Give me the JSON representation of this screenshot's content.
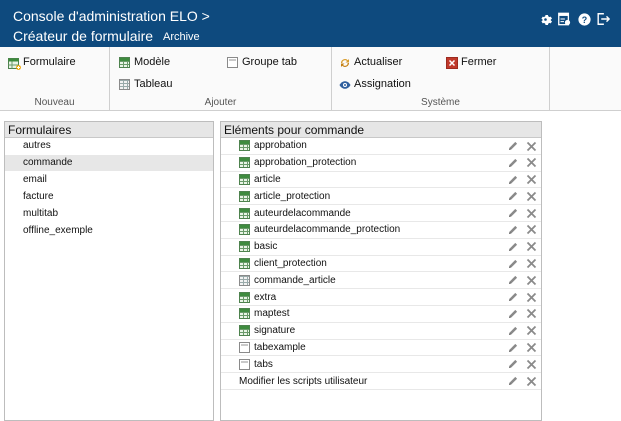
{
  "header": {
    "title_line1": "Console d'administration ELO >",
    "title_line2": "Créateur de formulaire",
    "breadcrumb": "Archive",
    "icons": [
      "gear-icon",
      "document-settings-icon",
      "help-icon",
      "logout-icon"
    ]
  },
  "ribbon": {
    "groups": {
      "nouveau": {
        "label": "Nouveau",
        "formulaire": "Formulaire"
      },
      "ajouter": {
        "label": "Ajouter",
        "modele": "Modèle",
        "tableau": "Tableau",
        "groupe_tab": "Groupe tab"
      },
      "systeme": {
        "label": "Système",
        "actualiser": "Actualiser",
        "fermer": "Fermer",
        "assignation": "Assignation"
      }
    }
  },
  "forms_panel": {
    "title": "Formulaires",
    "items": [
      "autres",
      "commande",
      "email",
      "facture",
      "multitab",
      "offline_exemple"
    ],
    "selected": "commande"
  },
  "elements_panel": {
    "title": "Eléments pour commande",
    "items": [
      {
        "label": "approbation",
        "icon": "green-grid-icon"
      },
      {
        "label": "approbation_protection",
        "icon": "green-grid-icon"
      },
      {
        "label": "article",
        "icon": "green-grid-icon"
      },
      {
        "label": "article_protection",
        "icon": "green-grid-icon"
      },
      {
        "label": "auteurdelacommande",
        "icon": "green-grid-icon"
      },
      {
        "label": "auteurdelacommande_protection",
        "icon": "green-grid-icon"
      },
      {
        "label": "basic",
        "icon": "green-grid-icon"
      },
      {
        "label": "client_protection",
        "icon": "green-grid-icon"
      },
      {
        "label": "commande_article",
        "icon": "table-icon"
      },
      {
        "label": "extra",
        "icon": "green-grid-icon"
      },
      {
        "label": "maptest",
        "icon": "green-grid-icon"
      },
      {
        "label": "signature",
        "icon": "green-grid-icon"
      },
      {
        "label": "tabexample",
        "icon": "page-icon"
      },
      {
        "label": "tabs",
        "icon": "page-icon"
      },
      {
        "label": "Modifier les scripts utilisateur",
        "icon": ""
      }
    ]
  },
  "colors": {
    "header_bg": "#0e4a7e",
    "fermer_icon": "#c0392b",
    "grid_icon": "#3e8b3e"
  }
}
